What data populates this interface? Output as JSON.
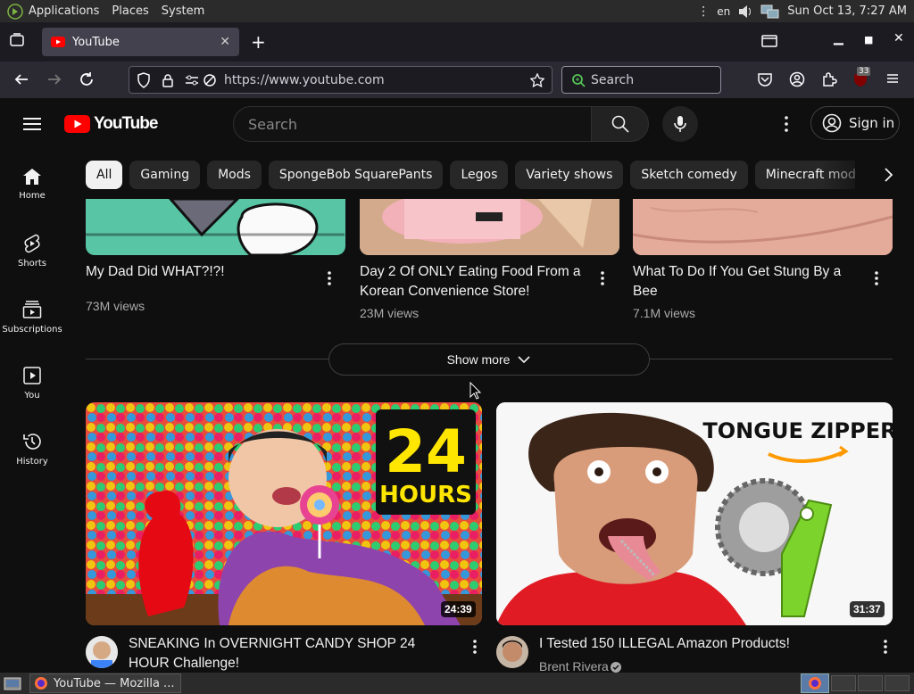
{
  "panel": {
    "applications": "Applications",
    "places": "Places",
    "system": "System",
    "lang": "en",
    "clock": "Sun Oct 13,  7:27 AM"
  },
  "browser": {
    "tab_title": "YouTube",
    "url": "https://www.youtube.com",
    "search_placeholder": "Search",
    "badge": "33"
  },
  "youtube": {
    "logo_text": "YouTube",
    "search_placeholder": "Search",
    "signin_label": "Sign in",
    "chips": [
      "All",
      "Gaming",
      "Mods",
      "SpongeBob SquarePants",
      "Legos",
      "Variety shows",
      "Sketch comedy",
      "Minecraft modding"
    ],
    "sidebar": [
      {
        "label": "Home",
        "icon": "home-icon"
      },
      {
        "label": "Shorts",
        "icon": "shorts-icon"
      },
      {
        "label": "Subscriptions",
        "icon": "subscriptions-icon"
      },
      {
        "label": "You",
        "icon": "you-icon"
      },
      {
        "label": "History",
        "icon": "history-icon"
      }
    ],
    "shorts": [
      {
        "title": "My Dad Did WHAT?!?!",
        "views": "73M views"
      },
      {
        "title": "Day 2 Of ONLY Eating Food From a Korean Convenience Store!",
        "views": "23M views"
      },
      {
        "title": "What To Do If You Get Stung By a Bee",
        "views": "7.1M views"
      }
    ],
    "show_more": "Show more",
    "videos": [
      {
        "title": "SNEAKING In OVERNIGHT CANDY SHOP 24 HOUR Challenge!",
        "channel": "",
        "duration": "24:39",
        "thumb_text": "24 HOURS"
      },
      {
        "title": "I Tested 150 ILLEGAL Amazon Products!",
        "channel": "Brent Rivera",
        "duration": "31:37",
        "thumb_text": "TONGUE ZIPPER"
      }
    ]
  },
  "taskbar": {
    "window_title": "YouTube — Mozilla ..."
  }
}
